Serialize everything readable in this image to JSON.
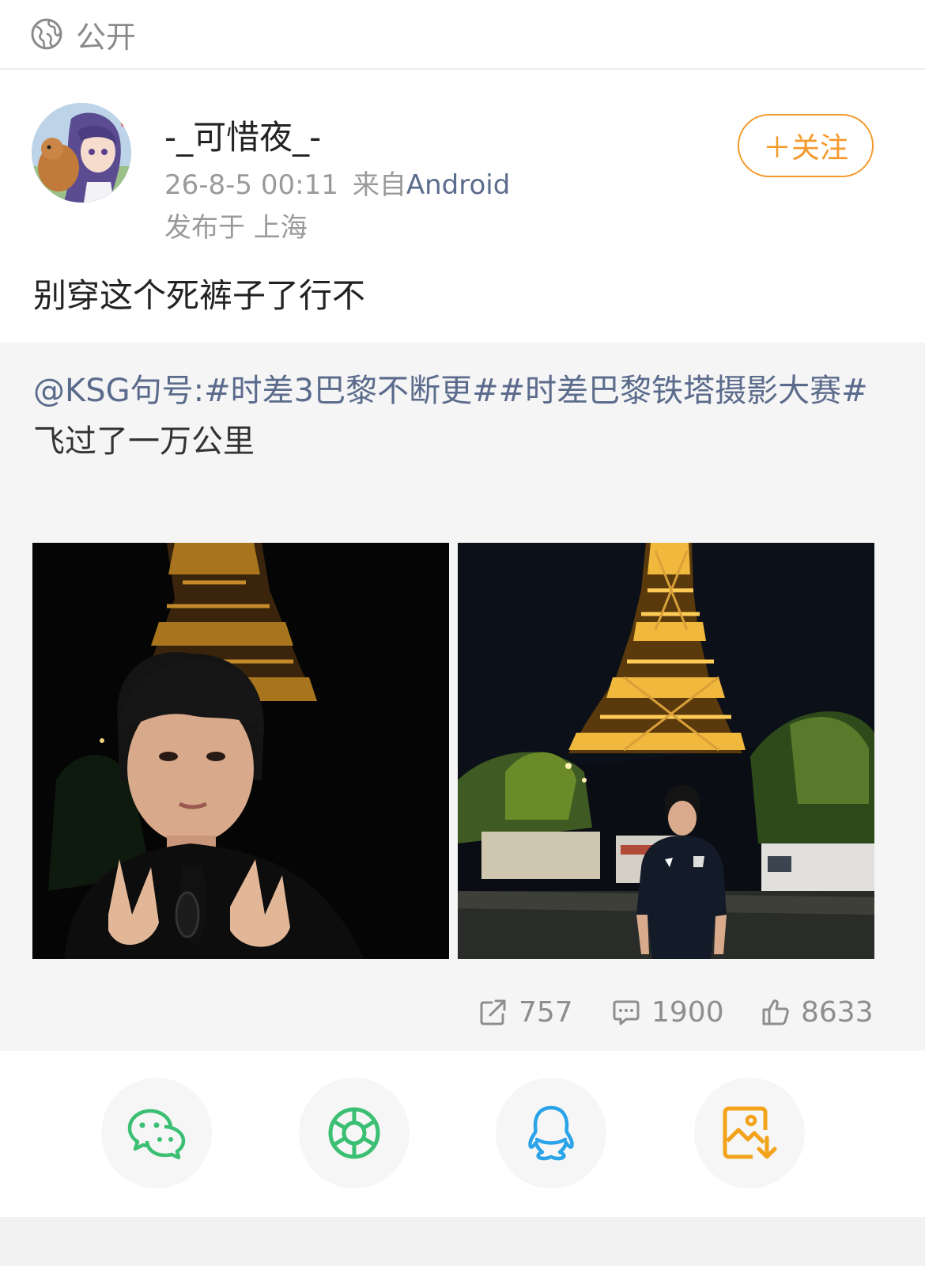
{
  "visibility": {
    "label": "公开",
    "icon": "globe-icon"
  },
  "author": {
    "name": "-_可惜夜_-",
    "timestamp": "26-8-5 00:11",
    "source_prefix": "来自",
    "source": "Android",
    "location": "发布于 上海",
    "follow_label": "＋关注"
  },
  "post": {
    "text": "别穿这个死裤子了行不"
  },
  "repost": {
    "mention": "@KSG句号",
    "colon": ":",
    "hashtags": "#时差3巴黎不断更##时差巴黎铁塔摄影大赛#",
    "body": "飞过了一万公里"
  },
  "stats": {
    "reposts": "757",
    "comments": "1900",
    "likes": "8633"
  },
  "share": [
    "wechat-icon",
    "moments-icon",
    "qq-icon",
    "save-image-icon"
  ],
  "colors": {
    "accent": "#f39a2b",
    "link": "#5b6b8c",
    "wechat": "#3bbf73",
    "qq": "#2aa3e8",
    "save": "#f2a21b"
  }
}
